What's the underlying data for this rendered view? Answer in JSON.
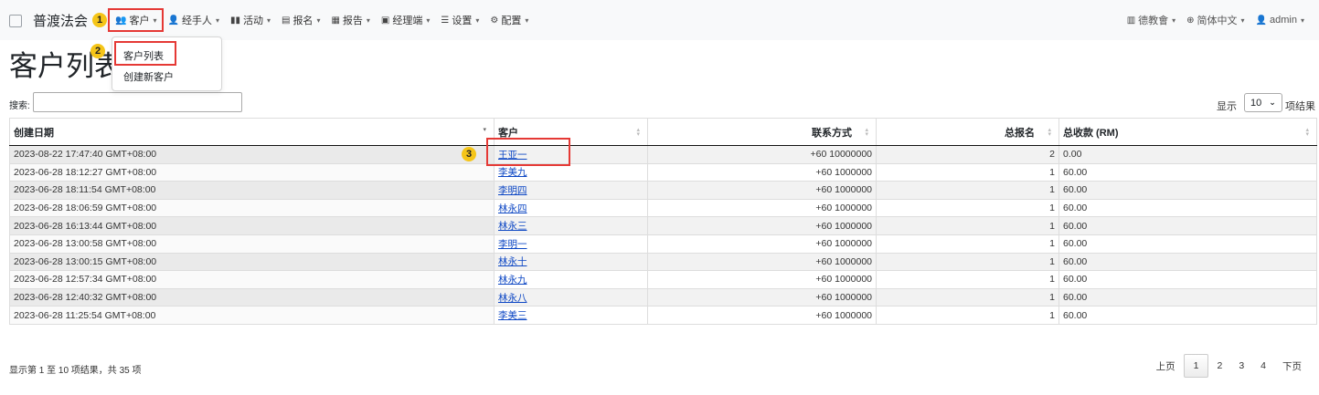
{
  "nav": {
    "brand": "普渡法会",
    "items": [
      {
        "label": "客户",
        "icon": "users-icon",
        "glyph": "👥"
      },
      {
        "label": "经手人",
        "icon": "user-icon",
        "glyph": "👤"
      },
      {
        "label": "活动",
        "icon": "map-icon",
        "glyph": "▮▮"
      },
      {
        "label": "报名",
        "icon": "form-icon",
        "glyph": "▤"
      },
      {
        "label": "报告",
        "icon": "report-icon",
        "glyph": "▦"
      },
      {
        "label": "经理端",
        "icon": "briefcase-icon",
        "glyph": "▣"
      },
      {
        "label": "设置",
        "icon": "list-icon",
        "glyph": "☰"
      },
      {
        "label": "配置",
        "icon": "gear-icon",
        "glyph": "⚙"
      }
    ],
    "right": [
      {
        "label": "德教會",
        "icon": "building-icon",
        "glyph": "▥"
      },
      {
        "label": "简体中文",
        "icon": "globe-icon",
        "glyph": "⊕"
      },
      {
        "label": "admin",
        "icon": "user-icon",
        "glyph": "👤"
      }
    ]
  },
  "dropdown": {
    "items": [
      "客户列表",
      "创建新客户"
    ]
  },
  "page": {
    "title": "客户列表"
  },
  "search": {
    "label": "搜索:",
    "value": ""
  },
  "length": {
    "prefix": "显示",
    "value": "10",
    "suffix": "项结果"
  },
  "table": {
    "columns": [
      "创建日期",
      "客户",
      "联系方式",
      "总报名",
      "总收款 (RM)"
    ],
    "rows": [
      [
        "2023-08-22 17:47:40 GMT+08:00",
        "王亚一",
        "+60 10000000",
        "2",
        "0.00"
      ],
      [
        "2023-06-28 18:12:27 GMT+08:00",
        "李美九",
        "+60 1000000",
        "1",
        "60.00"
      ],
      [
        "2023-06-28 18:11:54 GMT+08:00",
        "李明四",
        "+60 1000000",
        "1",
        "60.00"
      ],
      [
        "2023-06-28 18:06:59 GMT+08:00",
        "林永四",
        "+60 1000000",
        "1",
        "60.00"
      ],
      [
        "2023-06-28 16:13:44 GMT+08:00",
        "林永三",
        "+60 1000000",
        "1",
        "60.00"
      ],
      [
        "2023-06-28 13:00:58 GMT+08:00",
        "李明一",
        "+60 1000000",
        "1",
        "60.00"
      ],
      [
        "2023-06-28 13:00:15 GMT+08:00",
        "林永十",
        "+60 1000000",
        "1",
        "60.00"
      ],
      [
        "2023-06-28 12:57:34 GMT+08:00",
        "林永九",
        "+60 1000000",
        "1",
        "60.00"
      ],
      [
        "2023-06-28 12:40:32 GMT+08:00",
        "林永八",
        "+60 1000000",
        "1",
        "60.00"
      ],
      [
        "2023-06-28 11:25:54 GMT+08:00",
        "李美三",
        "+60 1000000",
        "1",
        "60.00"
      ]
    ]
  },
  "footer": {
    "info": "显示第 1 至 10 项结果，共 35 项",
    "pager": {
      "prev": "上页",
      "pages": [
        "1",
        "2",
        "3",
        "4"
      ],
      "current": "1",
      "next": "下页"
    }
  },
  "annotations": [
    "1",
    "2",
    "3"
  ],
  "colors": {
    "highlight": "#e53935",
    "badge": "#f5c518",
    "link": "#0d47c4"
  }
}
